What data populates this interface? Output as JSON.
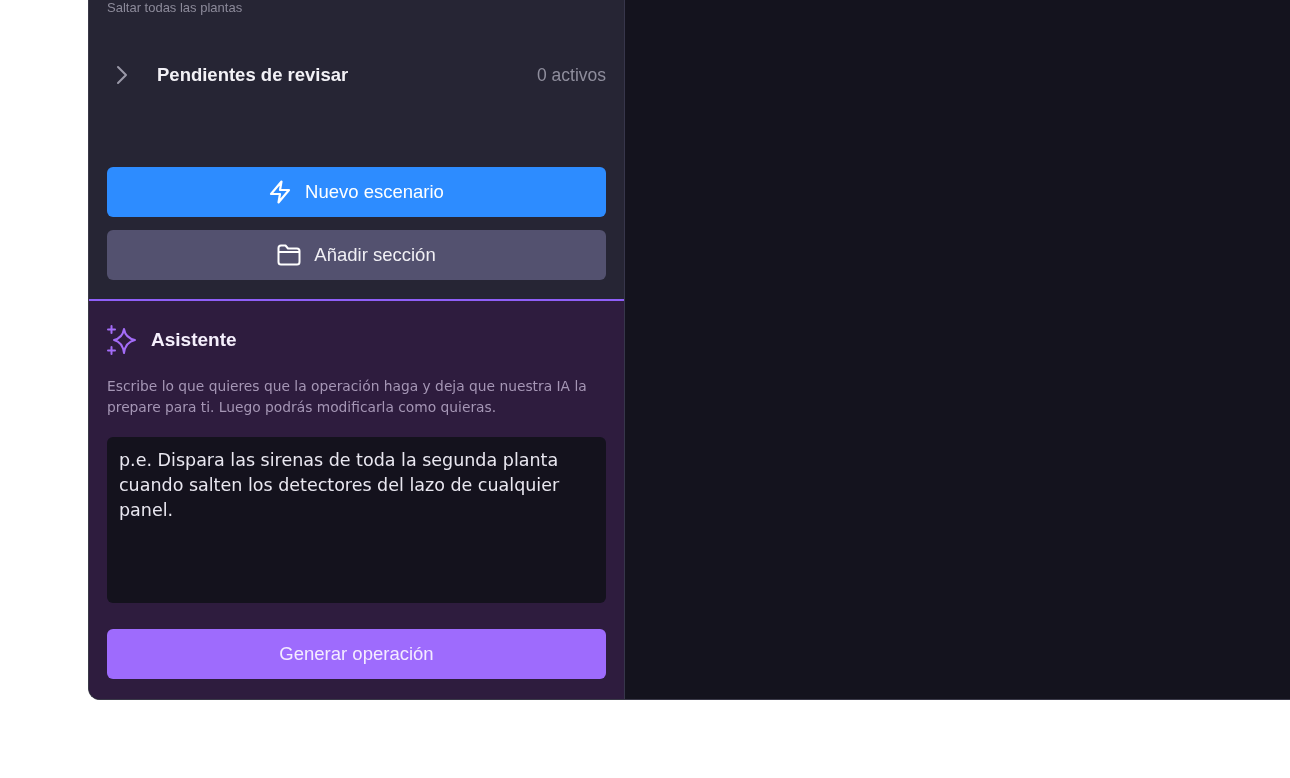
{
  "sidebar": {
    "caption": "Saltar todas las plantas",
    "groups": [
      {
        "label": "Pendientes de revisar",
        "count": "0 activos",
        "expanded": false
      }
    ],
    "actions": [
      {
        "label": "Nuevo escenario",
        "kind": "primary"
      },
      {
        "label": "Añadir sección",
        "kind": "secondary"
      }
    ]
  },
  "assistant": {
    "title": "Asistente",
    "description": "Escribe lo que quieres que la operación haga y deja que nuestra IA la prepare para ti. Luego podrás modificarla como quieras.",
    "prompt": {
      "placeholder": "p.e. Dispara las sirenas de toda la segunda planta cuando salten los detectores del lazo de cualquier panel."
    },
    "submit": "Generar operación"
  }
}
